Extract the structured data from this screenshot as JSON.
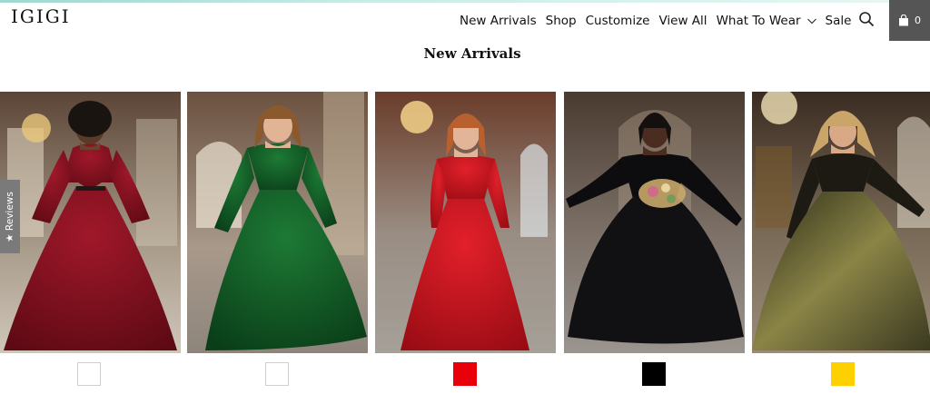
{
  "brand": {
    "logo": "IGIGI"
  },
  "nav": {
    "items": [
      {
        "label": "New Arrivals"
      },
      {
        "label": "Shop"
      },
      {
        "label": "Customize"
      },
      {
        "label": "View All"
      },
      {
        "label": "What To Wear"
      },
      {
        "label": "Sale"
      }
    ],
    "cart_count": "0"
  },
  "section": {
    "title": "New Arrivals"
  },
  "reviews_tab": {
    "label": "★ Reviews"
  },
  "products": [
    {
      "dress_color": "#7a0e1a",
      "swatch_color": "#ffffff"
    },
    {
      "dress_color": "#0f5a23",
      "swatch_color": "#ffffff"
    },
    {
      "dress_color": "#c0141c",
      "swatch_color": "#e8000b"
    },
    {
      "dress_color": "#0c0c0f",
      "swatch_color": "#000000"
    },
    {
      "dress_color": "#5e5a2a",
      "swatch_color": "#ffd000"
    }
  ],
  "colors": {
    "cart_bg": "#555555",
    "reviews_bg": "#7a7a7a"
  },
  "icons": {
    "search": "search-icon",
    "cart": "shopping-bag-icon",
    "dropdown": "chevron-down-icon"
  }
}
